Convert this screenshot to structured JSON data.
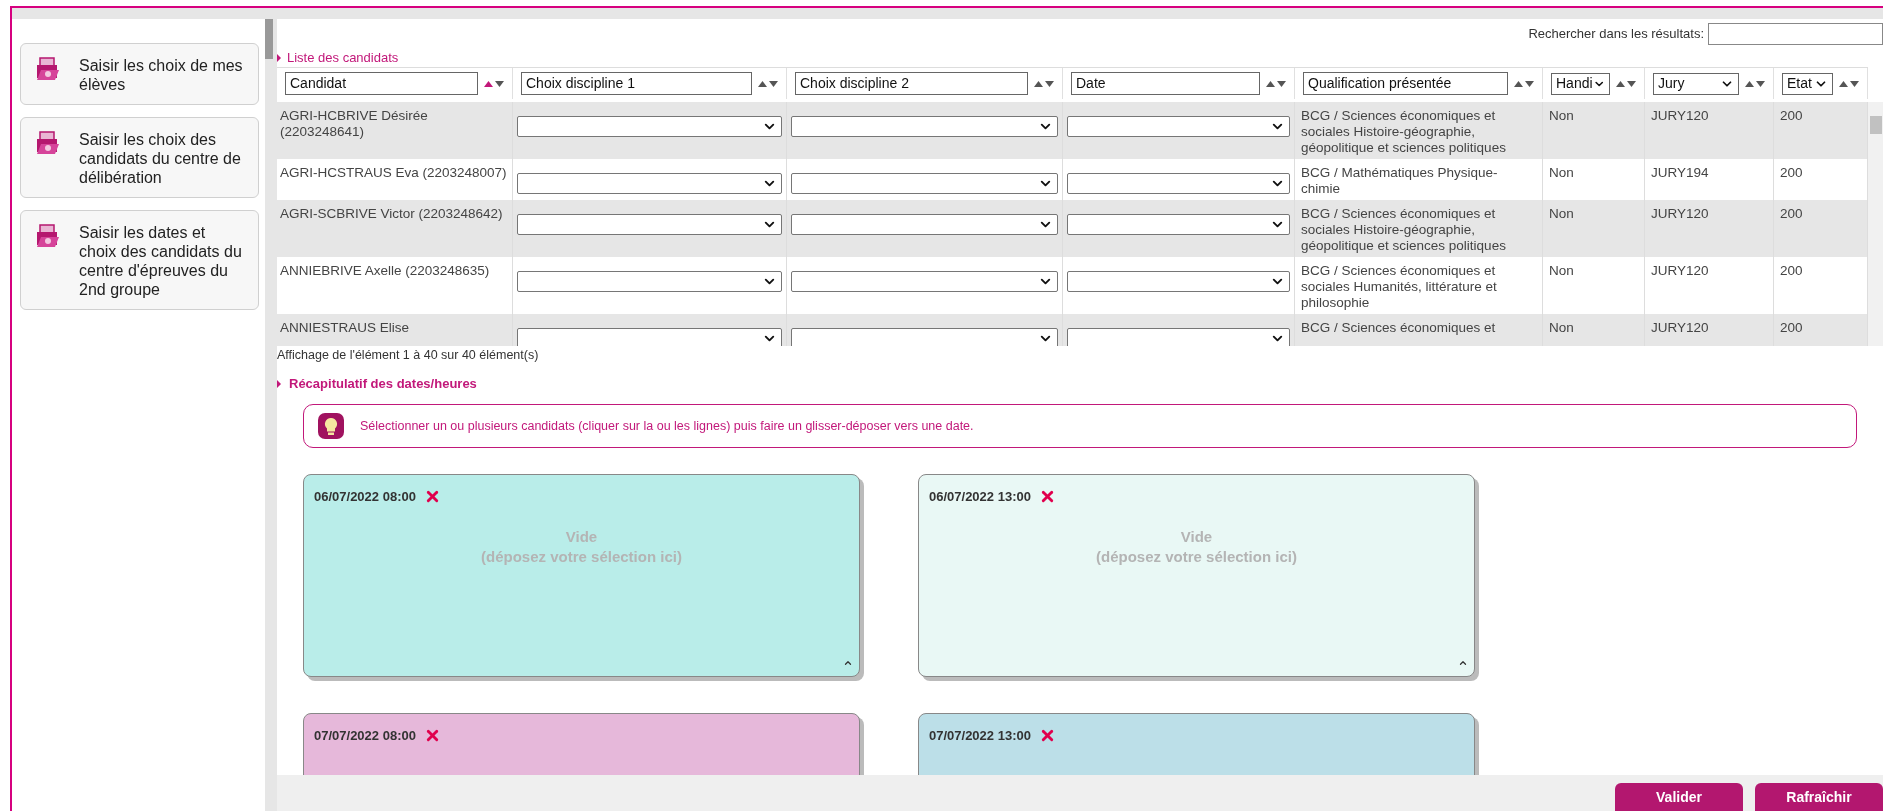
{
  "sidebar": {
    "items": [
      {
        "label": "Saisir les choix de mes élèves"
      },
      {
        "label": "Saisir les choix des candidats du centre de délibération"
      },
      {
        "label": "Saisir les dates et choix des candidats du centre d'épreuves du 2nd groupe"
      }
    ]
  },
  "search": {
    "label": "Rechercher dans les résultats:"
  },
  "candidates": {
    "title": "Liste des candidats",
    "columns": [
      {
        "label": "Candidat",
        "kind": "text",
        "sorted": true
      },
      {
        "label": "Choix discipline 1",
        "kind": "text",
        "sorted": false
      },
      {
        "label": "Choix discipline 2",
        "kind": "text",
        "sorted": false
      },
      {
        "label": "Date",
        "kind": "text",
        "sorted": false
      },
      {
        "label": "Qualification présentée",
        "kind": "text",
        "sorted": false
      },
      {
        "label": "Handi",
        "kind": "select",
        "sorted": false
      },
      {
        "label": "Jury",
        "kind": "select",
        "sorted": false
      },
      {
        "label": "Etat",
        "kind": "select",
        "sorted": false
      }
    ],
    "rows": [
      {
        "candidat": "AGRI-HCBRIVE Désirée (2203248641)",
        "qualification": "BCG / Sciences économiques et sociales Histoire-géographie, géopolitique et sciences politiques",
        "handi": "Non",
        "jury": "JURY120",
        "etat": "200"
      },
      {
        "candidat": "AGRI-HCSTRAUS Eva (2203248007)",
        "qualification": "BCG / Mathématiques Physique-chimie",
        "handi": "Non",
        "jury": "JURY194",
        "etat": "200"
      },
      {
        "candidat": "AGRI-SCBRIVE Victor (2203248642)",
        "qualification": "BCG / Sciences économiques et sociales Histoire-géographie, géopolitique et sciences politiques",
        "handi": "Non",
        "jury": "JURY120",
        "etat": "200"
      },
      {
        "candidat": "ANNIEBRIVE Axelle (2203248635)",
        "qualification": "BCG / Sciences économiques et sociales Humanités, littérature et philosophie",
        "handi": "Non",
        "jury": "JURY120",
        "etat": "200"
      },
      {
        "candidat": "ANNIESTRAUS Elise",
        "qualification": "BCG / Sciences économiques et",
        "handi": "Non",
        "jury": "JURY120",
        "etat": "200"
      }
    ],
    "info": "Affichage de l'élément 1 à 40 sur 40 élément(s)"
  },
  "summary": {
    "title": "Récapitulatif des dates/heures",
    "hint": "Sélectionner un ou plusieurs candidats (cliquer sur la ou les lignes) puis faire un glisser-déposer vers une date.",
    "slots": [
      {
        "date": "06/07/2022 08:00",
        "color": "#b9ede9",
        "empty_text": "Vide",
        "empty_hint": "(déposez votre sélection ici)"
      },
      {
        "date": "06/07/2022 13:00",
        "color": "#e9f8f5",
        "empty_text": "Vide",
        "empty_hint": "(déposez votre sélection ici)"
      },
      {
        "date": "07/07/2022 08:00",
        "color": "#e6b8da"
      },
      {
        "date": "07/07/2022 13:00",
        "color": "#bcdfe8"
      }
    ]
  },
  "buttons": [
    {
      "label": "Valider"
    },
    {
      "label": "Rafraîchir"
    }
  ]
}
